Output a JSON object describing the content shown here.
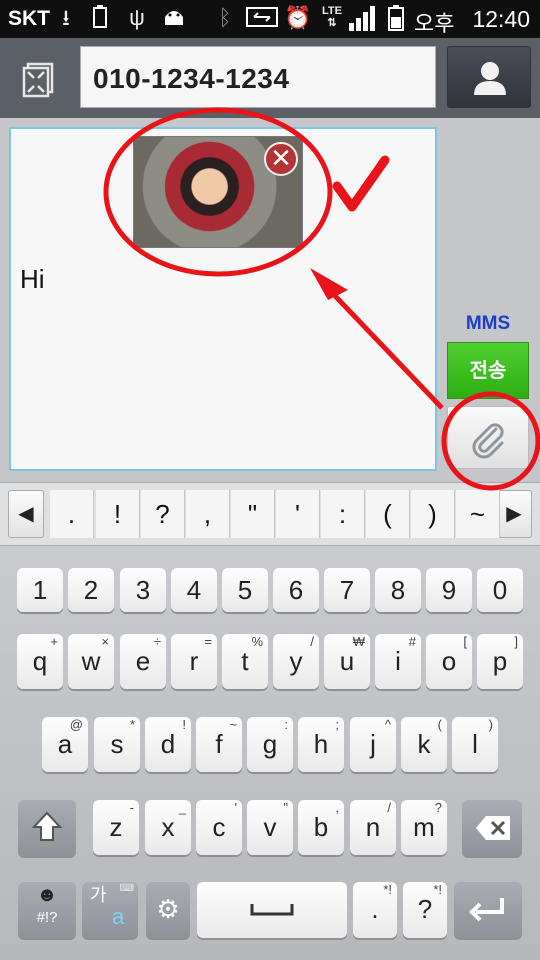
{
  "status_bar": {
    "carrier": "SKT",
    "ampm": "오후",
    "time": "12:40",
    "icons": [
      "download-icon",
      "battery-saver-icon",
      "usb-icon",
      "android-debug-icon",
      "bluetooth-icon",
      "screen-mirroring-icon",
      "alarm-icon",
      "lte-icon",
      "signal-icon",
      "battery-icon"
    ],
    "lte_label": "LTE"
  },
  "header": {
    "recipient_value": "010-1234-1234"
  },
  "compose": {
    "message_text": "Hi",
    "message_type": "MMS",
    "send_label": "전송"
  },
  "symbols": [
    ".",
    "!",
    "?",
    ",",
    "\"",
    "'",
    ":",
    "(",
    ")",
    "~"
  ],
  "keyboard": {
    "numbers": [
      "1",
      "2",
      "3",
      "4",
      "5",
      "6",
      "7",
      "8",
      "9",
      "0"
    ],
    "row1": [
      {
        "k": "q",
        "s": "+"
      },
      {
        "k": "w",
        "s": "×"
      },
      {
        "k": "e",
        "s": "÷"
      },
      {
        "k": "r",
        "s": "="
      },
      {
        "k": "t",
        "s": "%"
      },
      {
        "k": "y",
        "s": "/"
      },
      {
        "k": "u",
        "s": "₩"
      },
      {
        "k": "i",
        "s": "#"
      },
      {
        "k": "o",
        "s": "["
      },
      {
        "k": "p",
        "s": "]"
      }
    ],
    "row2": [
      {
        "k": "a",
        "s": "@"
      },
      {
        "k": "s",
        "s": "*"
      },
      {
        "k": "d",
        "s": "!"
      },
      {
        "k": "f",
        "s": "~"
      },
      {
        "k": "g",
        "s": ":"
      },
      {
        "k": "h",
        "s": ";"
      },
      {
        "k": "j",
        "s": "^"
      },
      {
        "k": "k",
        "s": "("
      },
      {
        "k": "l",
        "s": ")"
      }
    ],
    "row3": [
      {
        "k": "z",
        "s": "-"
      },
      {
        "k": "x",
        "s": "_"
      },
      {
        "k": "c",
        "s": "'"
      },
      {
        "k": "v",
        "s": "\""
      },
      {
        "k": "b",
        "s": ","
      },
      {
        "k": "n",
        "s": "/"
      },
      {
        "k": "m",
        "s": "?"
      }
    ],
    "symbols_key": "#!?",
    "lang_key_top": "가",
    "lang_key_bottom": "a",
    "period_key": ".",
    "question_key": "?",
    "period_sub": "*!",
    "question_sub": "*!"
  },
  "colors": {
    "accent_send": "#3cbd1f",
    "mms_label": "#1d40c8",
    "annotation": "#e8141a",
    "editor_border": "#79c7e3"
  }
}
